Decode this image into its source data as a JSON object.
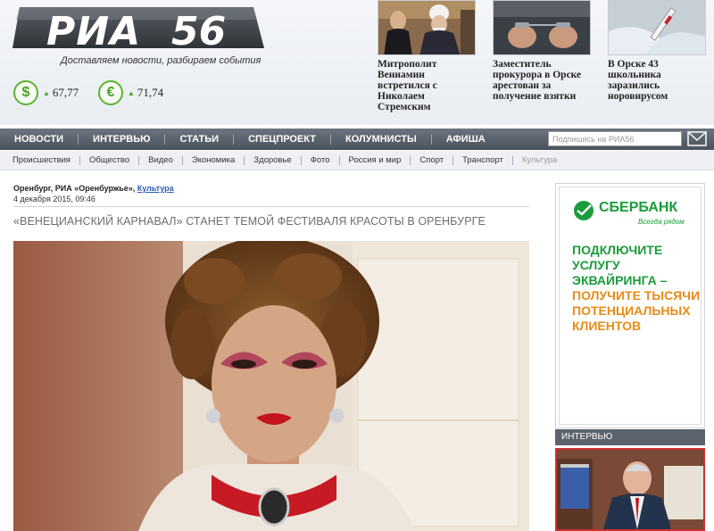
{
  "site": {
    "logo_word": "РИА",
    "logo_number": "56",
    "tagline": "Доставляем новости, разбираем события"
  },
  "rates": [
    {
      "symbol": "$",
      "value": "67,77",
      "trend": "up"
    },
    {
      "symbol": "€",
      "value": "71,74",
      "trend": "up"
    }
  ],
  "top_news": [
    {
      "title": "Митрополит Вениамин встретился с Николаем Стремским",
      "image": "clergy-photo"
    },
    {
      "title": "Заместитель прокурора в Орске арестован за получение взятки",
      "image": "handcuffed-hands-photo"
    },
    {
      "title": "В Орске 43 школьника заразились норовирусом",
      "image": "syringe-glove-photo"
    }
  ],
  "main_nav": {
    "items": [
      "НОВОСТИ",
      "ИНТЕРВЬЮ",
      "СТАТЬИ",
      "СПЕЦПРОЕКТ",
      "КОЛУМНИСТЫ",
      "АФИША"
    ],
    "subscribe_placeholder": "Подпишись на РИА56"
  },
  "sub_nav": {
    "items": [
      "Происшествия",
      "Общество",
      "Видео",
      "Экономика",
      "Здоровье",
      "Фото",
      "Россия и мир",
      "Спорт",
      "Транспорт",
      "Культура"
    ],
    "active": "Культура"
  },
  "article": {
    "source": "Оренбург, РИА «Оренбуржье»,",
    "category": "Культура",
    "date": "4 декабря 2015, 09:46",
    "headline": "«Венецианский карнавал» станет темой фестиваля красоты в Оренбурге"
  },
  "ad": {
    "brand": "СБЕРБАНК",
    "slogan": "Всегда рядом",
    "lines_green": [
      "ПОДКЛЮЧИТЕ",
      "УСЛУГУ",
      "ЭКВАЙРИНГА –"
    ],
    "lines_orange": [
      "ПОЛУЧИТЕ ТЫСЯЧИ",
      "ПОТЕНЦИАЛЬНЫХ",
      "КЛИЕНТОВ"
    ],
    "colors": {
      "green": "#1a9c3a",
      "orange": "#e68b17"
    }
  },
  "sidebar": {
    "section_title": "ИНТЕРВЬЮ"
  }
}
